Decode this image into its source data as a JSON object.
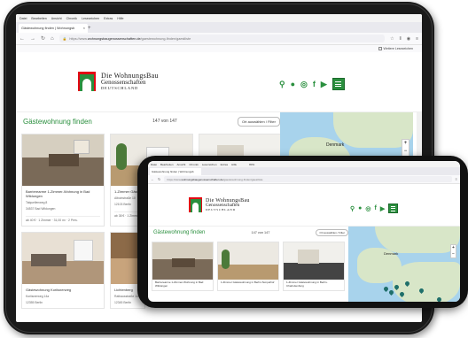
{
  "browser": {
    "menu": [
      "Datei",
      "Bearbeiten",
      "Ansicht",
      "Chronik",
      "Lesezeichen",
      "Extras",
      "Hilfe"
    ],
    "tab_title": "Gästewohnung finden | Wohnungsb",
    "url_prefix": "https://www.",
    "url_domain": "wohnungsbaugenossenschaften.de",
    "url_path": "/gaestewohnung-finden/gaestliste",
    "zoom": "80%",
    "bookmarks_label": "Weitere Lesezeichen"
  },
  "site": {
    "logo_line1": "Die WohnungsBau",
    "logo_line2": "Genossenschaften",
    "logo_line3": "DEUTSCHLAND",
    "icons": [
      "search-icon",
      "user-icon",
      "instagram-icon",
      "facebook-icon",
      "youtube-icon",
      "menu-icon"
    ]
  },
  "list": {
    "title": "Gästewohnung finden",
    "count": "147 von 147",
    "filter_button": "Ort auswählen / Filter",
    "map_label": "Denmark",
    "cards": [
      {
        "title": "Barrierearme 1-Zimmer-Wohnung in Bad Wildungen",
        "meta1": "Talquellenweg 8",
        "meta2": "34537 Bad Wildungen",
        "price": "ab 40 € · 1 Zimmer · 31,00 m² · 2 Pers."
      },
      {
        "title": "1-Zimmer Gästewohnung in Berlin-Tempelhof",
        "meta1": "Alboinstraße 10",
        "meta2": "12103 Berlin",
        "price": "ab 38 € · 1 Zimmer"
      },
      {
        "title": "1-Zimmer Gästewohnung in Berlin-Charlottenburg",
        "meta1": "",
        "meta2": "",
        "price": ""
      },
      {
        "title": "Gästewohnung Koriisnerweg",
        "meta1": "Koriisnerweg 14a",
        "meta2": "12355 Berlin",
        "price": ""
      },
      {
        "title": "Lichtenberg",
        "meta1": "Rathausstraße 14",
        "meta2": "12345 Berlin",
        "price": ""
      }
    ]
  },
  "phone": {
    "cards": [
      {
        "title": "Barrierearme 1-Zimmer-Wohnung in Bad Wildungen"
      },
      {
        "title": "1-Zimmer Gästewohnung in Berlin-Tempelhof"
      },
      {
        "title": "1-Zimmer Gästewohnung in Berlin-Charlottenburg"
      }
    ]
  },
  "colors": {
    "brand_green": "#2a8f3e",
    "brand_red": "#e30613",
    "map_water": "#a8d3ec",
    "map_land": "#d8e6c8"
  }
}
